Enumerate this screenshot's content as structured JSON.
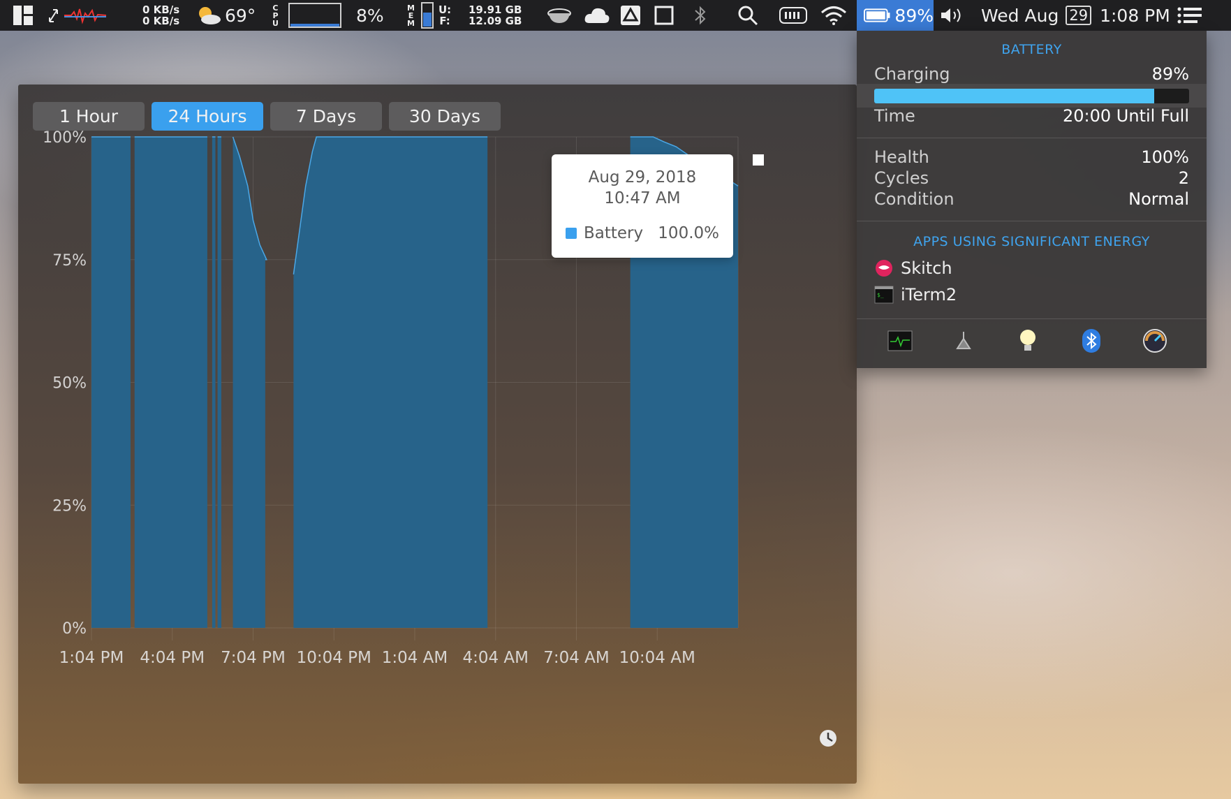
{
  "menubar": {
    "net_up": "0 KB/s",
    "net_down": "0 KB/s",
    "temperature": "69°",
    "cpu_label": [
      "C",
      "P",
      "U"
    ],
    "cpu_percent": "8%",
    "mem_label": [
      "M",
      "E",
      "M"
    ],
    "mem_used_label": "U:",
    "mem_free_label": "F:",
    "mem_used": "19.91 GB",
    "mem_free": "12.09 GB",
    "battery_percent": "89%",
    "day": "Wed",
    "month": "Aug",
    "date_badge": "29",
    "time": "1:08 PM",
    "icons": [
      "grid-layout-icon",
      "cursor-arrows-icon",
      "activity-graph-icon",
      "weather-icon",
      "cpu-graph-icon",
      "memory-bar-icon",
      "coffee-cup-icon",
      "cloud-icon",
      "drive-icon",
      "crop-icon",
      "bluetooth-icon",
      "search-icon",
      "keyboard-icon",
      "wifi-icon",
      "battery-icon",
      "volume-icon",
      "list-menu-icon"
    ]
  },
  "history": {
    "ranges": [
      {
        "label": "1 Hour",
        "active": false
      },
      {
        "label": "24 Hours",
        "active": true
      },
      {
        "label": "7 Days",
        "active": false
      },
      {
        "label": "30 Days",
        "active": false
      }
    ],
    "tooltip": {
      "date": "Aug 29, 2018",
      "time": "10:47 AM",
      "series": "Battery",
      "value": "100.0%"
    }
  },
  "chart_data": {
    "type": "area",
    "series": [
      {
        "name": "Battery",
        "color": "#27638a"
      }
    ],
    "y_ticks": [
      "100%",
      "75%",
      "50%",
      "25%",
      "0%"
    ],
    "ylim": [
      0,
      100
    ],
    "x_ticks": [
      "1:04 PM",
      "4:04 PM",
      "7:04 PM",
      "10:04 PM",
      "1:04 AM",
      "4:04 AM",
      "7:04 AM",
      "10:04 AM"
    ],
    "x_tick_hours": [
      0,
      3,
      6,
      9,
      12,
      15,
      18,
      21
    ],
    "xlim_hours": [
      0,
      24
    ],
    "segments": [
      {
        "points": [
          [
            0.0,
            100
          ],
          [
            1.45,
            100
          ]
        ]
      },
      {
        "points": [
          [
            1.6,
            100
          ],
          [
            4.3,
            100
          ]
        ]
      },
      {
        "points": [
          [
            4.48,
            100
          ],
          [
            4.6,
            100
          ]
        ]
      },
      {
        "points": [
          [
            4.68,
            100
          ],
          [
            4.82,
            100
          ]
        ]
      },
      {
        "points": [
          [
            5.25,
            100
          ],
          [
            5.5,
            96
          ],
          [
            5.8,
            90
          ],
          [
            6.0,
            83
          ],
          [
            6.25,
            78
          ],
          [
            6.5,
            75
          ],
          [
            6.45,
            75
          ]
        ]
      },
      {
        "points": [
          [
            7.5,
            72
          ],
          [
            7.7,
            80
          ],
          [
            7.95,
            90
          ],
          [
            8.2,
            97
          ],
          [
            8.35,
            100
          ],
          [
            14.7,
            100
          ]
        ]
      },
      {
        "points": [
          [
            20.0,
            100
          ],
          [
            20.85,
            100
          ],
          [
            21.25,
            99
          ],
          [
            21.7,
            98
          ],
          [
            22.1,
            96.5
          ],
          [
            22.5,
            95
          ],
          [
            22.9,
            94
          ],
          [
            23.3,
            92.5
          ],
          [
            24.0,
            90
          ]
        ]
      }
    ],
    "grid": true
  },
  "popover": {
    "battery_header": "BATTERY",
    "status_label": "Charging",
    "status_value": "89%",
    "charge_fraction": 0.89,
    "time_label": "Time",
    "time_value": "20:00 Until Full",
    "health_label": "Health",
    "health_value": "100%",
    "cycles_label": "Cycles",
    "cycles_value": "2",
    "condition_label": "Condition",
    "condition_value": "Normal",
    "apps_header": "APPS USING SIGNIFICANT ENERGY",
    "apps": [
      {
        "name": "Skitch",
        "icon": "skitch-app-icon"
      },
      {
        "name": "iTerm2",
        "icon": "iterm2-app-icon"
      }
    ],
    "dock_icons": [
      "activity-monitor-icon",
      "cleaner-icon",
      "light-bulb-icon",
      "bluetooth-icon",
      "disk-speed-icon"
    ]
  }
}
